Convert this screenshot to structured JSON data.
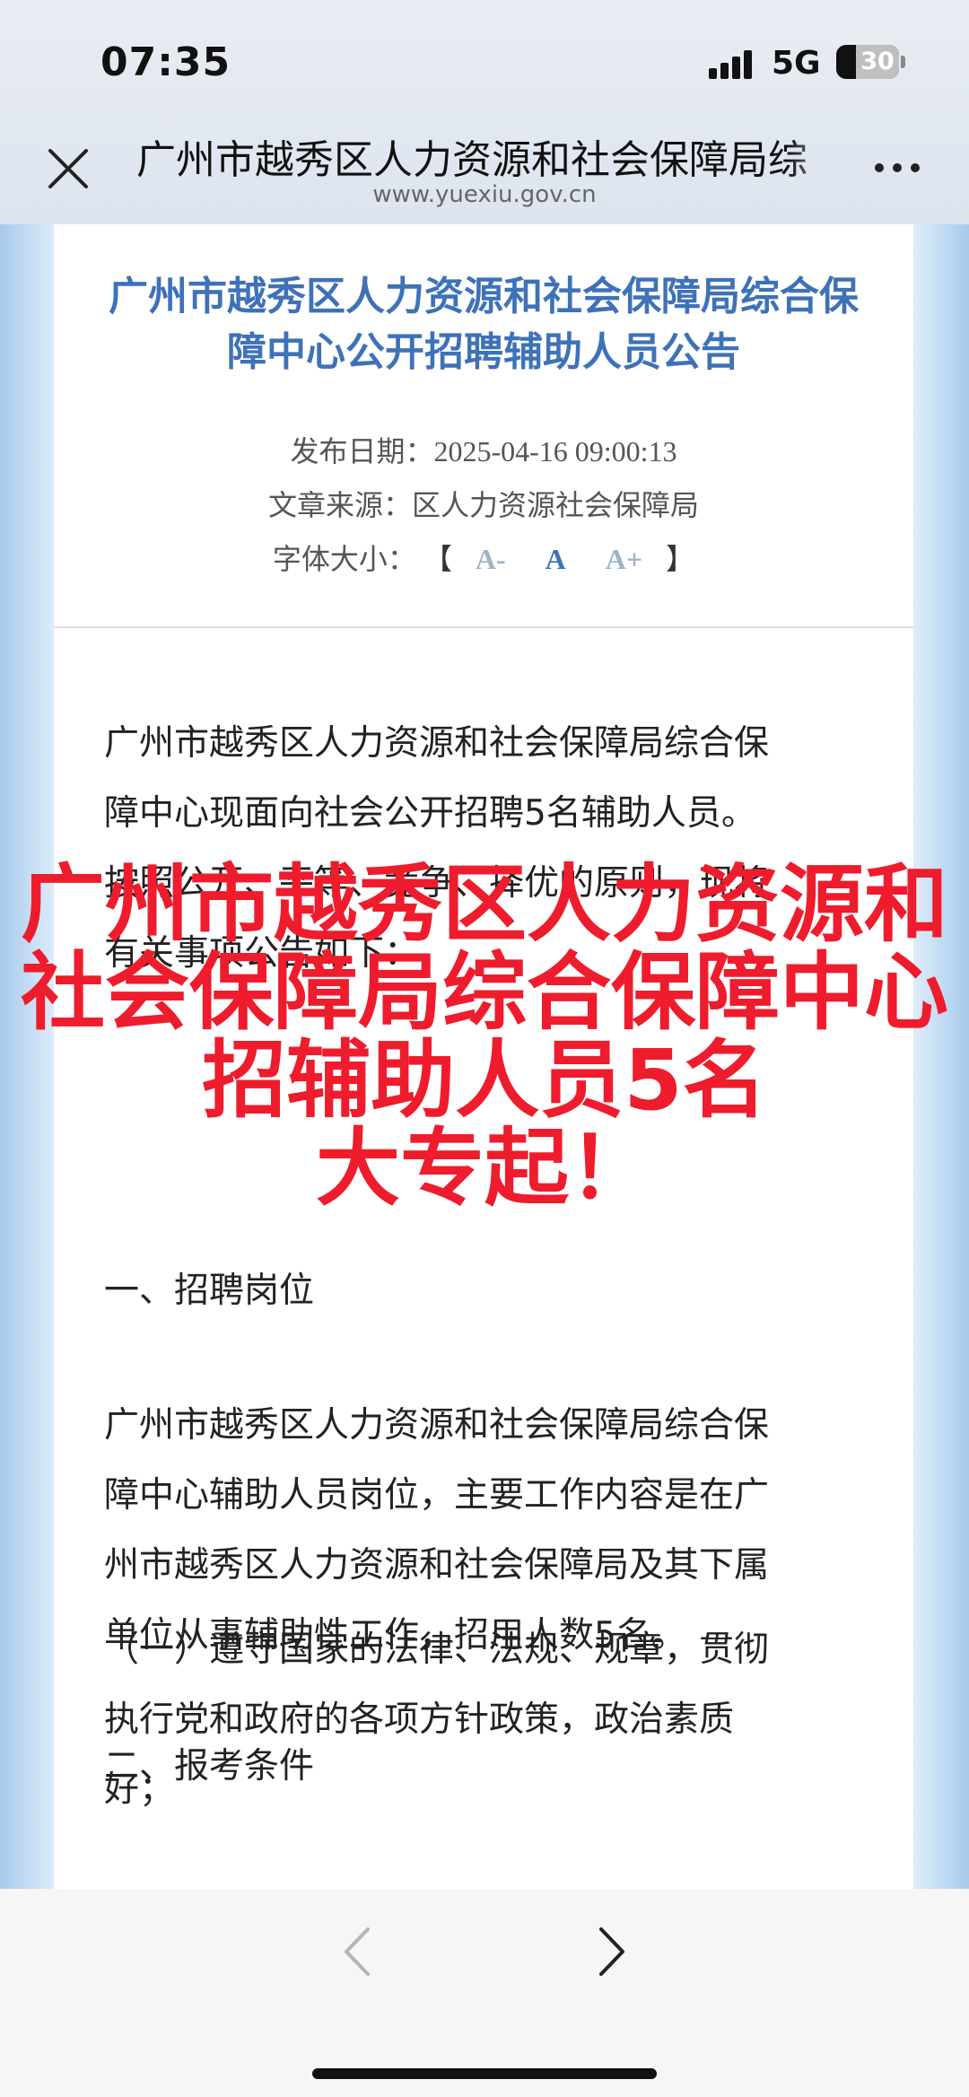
{
  "status_bar": {
    "time": "07:35",
    "network": "5G",
    "battery": "30",
    "icons": [
      "signal-icon",
      "battery-icon"
    ]
  },
  "browser": {
    "page_title": "广州市越秀区人力资源和社会保障局综",
    "domain": "www.yuexiu.gov.cn",
    "icons": [
      "close-icon",
      "more-icon"
    ]
  },
  "article": {
    "title_line1": "广州市越秀区人力资源和社会保障局综合保",
    "title_line2": "障中心公开招聘辅助人员公告",
    "publish_date_label": "发布日期：",
    "publish_date": "2025-04-16 09:00:13",
    "source_label": "文章来源：",
    "source": "区人力资源社会保障局",
    "font_size_label": "字体大小：",
    "bracket_open": "【",
    "bracket_close": "】",
    "font_small": "A-",
    "font_mid": "A",
    "font_big": "A+",
    "paragraph1_line1": "广州市越秀区人力资源和社会保障局综合保",
    "paragraph1_line2": "障中心现面向社会公开招聘5名辅助人员。",
    "paragraph1_line3": "按照公开、平等、竞争、择优的原则，现将",
    "paragraph1_line4": "有关事项公告如下：",
    "section1_heading": "一、招聘岗位",
    "paragraph2_line1": "广州市越秀区人力资源和社会保障局综合保",
    "paragraph2_line2": "障中心辅助人员岗位，主要工作内容是在广",
    "paragraph2_line3": "州市越秀区人力资源和社会保障局及其下属",
    "paragraph2_line4": "单位从事辅助性工作，招用人数5名。",
    "section2_heading": "二、报考条件",
    "paragraph3_line1": "（一）遵守国家的法律、法规、规章，贯彻",
    "paragraph3_line2": "执行党和政府的各项方针政策，政治素质",
    "paragraph3_line3": "好；"
  },
  "overlay": {
    "line1": "广州市越秀区人力资源和",
    "line2": "社会保障局综合保障中心",
    "line3": "招辅助人员5名",
    "line4": "大专起！",
    "color": "#ee1c2c"
  },
  "toolbar": {
    "icons": [
      "back-icon",
      "forward-icon"
    ]
  },
  "colors": {
    "title_blue": "#3e72b8",
    "side_blue": "#a8c9ea"
  }
}
